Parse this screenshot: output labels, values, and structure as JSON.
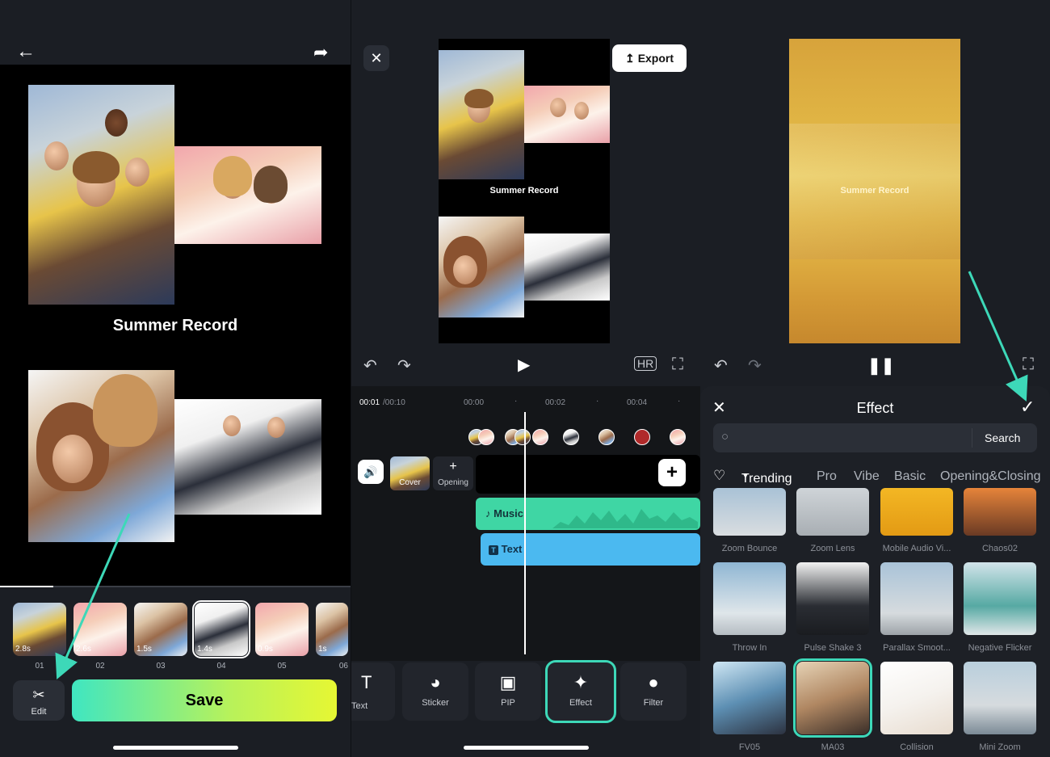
{
  "colors": {
    "accent": "#3dd8b8",
    "save_gradient_start": "#3fe6c1",
    "save_gradient_end": "#e6f733",
    "music_track": "#3fd6a4",
    "text_track": "#4bb9f0"
  },
  "panel1": {
    "back_icon": "back-arrow-icon",
    "share_icon": "share-icon",
    "canvas_title": "Summer Record",
    "thumbnails": [
      {
        "duration": "2.8s",
        "index": "01"
      },
      {
        "duration": "2.6s",
        "index": "02"
      },
      {
        "duration": "1.5s",
        "index": "03"
      },
      {
        "duration": "1.4s",
        "index": "04"
      },
      {
        "duration": "0.9s",
        "index": "05"
      },
      {
        "duration": "1s",
        "index": "06"
      }
    ],
    "edit_label": "Edit",
    "save_label": "Save"
  },
  "panel2": {
    "export_label": "Export",
    "canvas_title": "Summer Record",
    "time_current": "00:01",
    "time_total": "/00:10",
    "ruler": [
      "00:00",
      "00:02",
      "00:04"
    ],
    "cover_label": "Cover",
    "opening_label": "Opening",
    "music_label": "Music",
    "text_label": "Text",
    "tools": [
      {
        "label": "Text",
        "icon": "text-icon"
      },
      {
        "label": "Sticker",
        "icon": "sticker-icon"
      },
      {
        "label": "PIP",
        "icon": "pip-icon"
      },
      {
        "label": "Effect",
        "icon": "effect-icon"
      },
      {
        "label": "Filter",
        "icon": "filter-icon"
      }
    ]
  },
  "panel3": {
    "canvas_title": "Summer Record",
    "sheet_title": "Effect",
    "search_button": "Search",
    "categories": [
      "Trending",
      "Pro",
      "Vibe",
      "Basic",
      "Opening&Closing"
    ],
    "active_category": "Trending",
    "effects": [
      {
        "name": "Zoom Bounce"
      },
      {
        "name": "Zoom Lens"
      },
      {
        "name": "Mobile Audio Vi..."
      },
      {
        "name": "Chaos02"
      },
      {
        "name": "Throw In"
      },
      {
        "name": "Pulse Shake 3"
      },
      {
        "name": "Parallax Smoot..."
      },
      {
        "name": "Negative Flicker"
      },
      {
        "name": "FV05"
      },
      {
        "name": "MA03"
      },
      {
        "name": "Collision"
      },
      {
        "name": "Mini Zoom"
      }
    ]
  }
}
